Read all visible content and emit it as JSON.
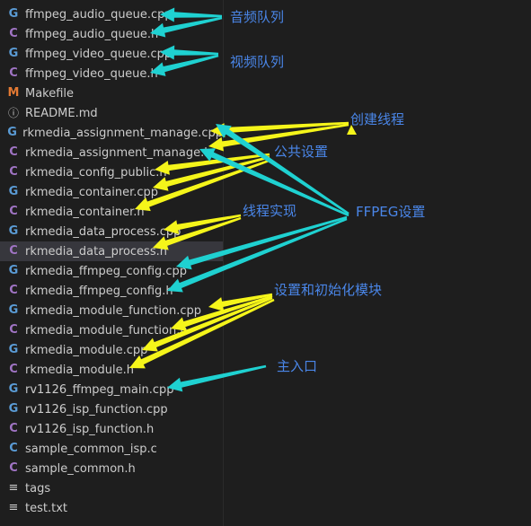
{
  "files": [
    {
      "name": "ffmpeg_audio_queue.cpp",
      "icon": "cpp-file-icon",
      "glyph": "G"
    },
    {
      "name": "ffmpeg_audio_queue.h",
      "icon": "c-header-file-icon",
      "glyph": "C"
    },
    {
      "name": "ffmpeg_video_queue.cpp",
      "icon": "cpp-file-icon",
      "glyph": "G"
    },
    {
      "name": "ffmpeg_video_queue.h",
      "icon": "c-header-file-icon",
      "glyph": "C"
    },
    {
      "name": "Makefile",
      "icon": "makefile-icon",
      "glyph": "M"
    },
    {
      "name": "README.md",
      "icon": "info-icon",
      "glyph": "ⓘ"
    },
    {
      "name": "rkmedia_assignment_manage.cpp",
      "icon": "cpp-file-icon",
      "glyph": "G"
    },
    {
      "name": "rkmedia_assignment_manage.h",
      "icon": "c-header-file-icon",
      "glyph": "C"
    },
    {
      "name": "rkmedia_config_public.h",
      "icon": "c-header-file-icon",
      "glyph": "C"
    },
    {
      "name": "rkmedia_container.cpp",
      "icon": "cpp-file-icon",
      "glyph": "G"
    },
    {
      "name": "rkmedia_container.h",
      "icon": "c-header-file-icon",
      "glyph": "C"
    },
    {
      "name": "rkmedia_data_process.cpp",
      "icon": "cpp-file-icon",
      "glyph": "G"
    },
    {
      "name": "rkmedia_data_process.h",
      "icon": "c-header-file-icon",
      "glyph": "C",
      "selected": true
    },
    {
      "name": "rkmedia_ffmpeg_config.cpp",
      "icon": "cpp-file-icon",
      "glyph": "G"
    },
    {
      "name": "rkmedia_ffmpeg_config.h",
      "icon": "c-header-file-icon",
      "glyph": "C"
    },
    {
      "name": "rkmedia_module_function.cpp",
      "icon": "cpp-file-icon",
      "glyph": "G"
    },
    {
      "name": "rkmedia_module_function.h",
      "icon": "c-header-file-icon",
      "glyph": "C"
    },
    {
      "name": "rkmedia_module.cpp",
      "icon": "cpp-file-icon",
      "glyph": "G"
    },
    {
      "name": "rkmedia_module.h",
      "icon": "c-header-file-icon",
      "glyph": "C"
    },
    {
      "name": "rv1126_ffmpeg_main.cpp",
      "icon": "cpp-file-icon",
      "glyph": "G"
    },
    {
      "name": "rv1126_isp_function.cpp",
      "icon": "cpp-file-icon",
      "glyph": "G"
    },
    {
      "name": "rv1126_isp_function.h",
      "icon": "c-header-file-icon",
      "glyph": "C"
    },
    {
      "name": "sample_common_isp.c",
      "icon": "c-file-icon",
      "glyph": "C"
    },
    {
      "name": "sample_common.h",
      "icon": "c-header-file-icon",
      "glyph": "C"
    },
    {
      "name": "tags",
      "icon": "text-lines-icon",
      "glyph": "≡"
    },
    {
      "name": "test.txt",
      "icon": "text-lines-icon",
      "glyph": "≡"
    }
  ],
  "annotations": {
    "audio_queue": "音频队列",
    "video_queue": "视频队列",
    "create_thread": "创建线程",
    "public_settings": "公共设置",
    "thread_impl": "线程实现",
    "ffpeg_settings": "FFPEG设置",
    "module_init": "设置和初始化模块",
    "main_entry": "主入口"
  },
  "colors": {
    "cyan_arrow": "#1fd1d1",
    "yellow_arrow": "#f5f51a",
    "annotation_text": "#4a86e8",
    "cpp_icon": "#5a9bd5",
    "header_icon": "#a074c4",
    "makefile_icon": "#e37933"
  }
}
